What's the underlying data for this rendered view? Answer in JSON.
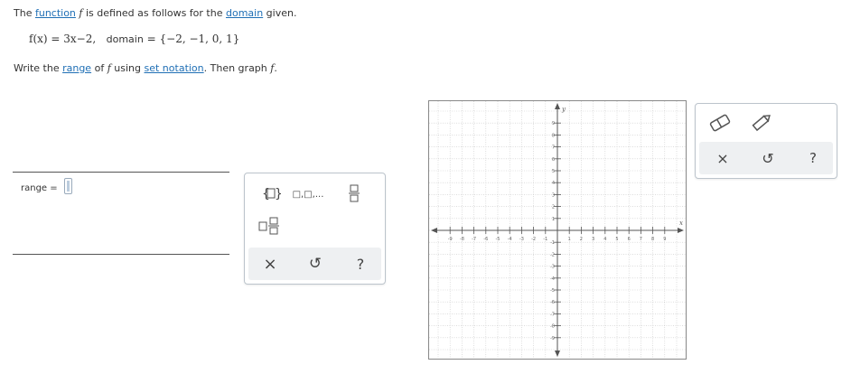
{
  "question": {
    "p1_before": "The ",
    "p1_link1": "function",
    "p1_fname": "f",
    "p1_mid": " is defined as follows for the ",
    "p1_link2": "domain",
    "p1_after": " given.",
    "eq_lhs": "f(x) = 3x−2,",
    "eq_domain_label": "domain",
    "eq_domain_value": "= {−2, −1, 0, 1}",
    "p3_before": "Write the ",
    "p3_link1": "range",
    "p3_mid": " of ",
    "p3_fname": "f",
    "p3_mid2": " using ",
    "p3_link2": "set notation",
    "p3_mid3": ". Then graph ",
    "p3_fname2": "f",
    "p3_end": "."
  },
  "answer": {
    "range_label": "range  =",
    "range_value": ""
  },
  "math_palette": {
    "buttons": [
      "set-braces",
      "list-items",
      "fraction",
      "mixed-number",
      "clear",
      "undo",
      "help"
    ],
    "set_list_label": "□,□,...",
    "help_label": "?",
    "clear_label": "×",
    "undo_label": "↺"
  },
  "graph": {
    "x_axis_label": "x",
    "y_axis_label": "y",
    "x_min": -10,
    "x_max": 10,
    "y_min": -10,
    "y_max": 10,
    "x_ticks": [
      -9,
      -8,
      -7,
      -6,
      -5,
      -4,
      -3,
      -2,
      -1,
      1,
      2,
      3,
      4,
      5,
      6,
      7,
      8,
      9
    ],
    "y_ticks": [
      9,
      8,
      7,
      6,
      5,
      4,
      3,
      2,
      1,
      -1,
      -2,
      -3,
      -4,
      -5,
      -6,
      -7,
      -8,
      -9
    ],
    "grid": true
  },
  "graph_tools": {
    "clear_label": "×",
    "undo_label": "↺",
    "help_label": "?",
    "tools": [
      "eraser-tool",
      "pencil-tool"
    ]
  },
  "colors": {
    "link": "#1f6fb5",
    "palette_border": "#bcc4cc",
    "strip_bg": "#eef0f2",
    "grid": "#c8c8c8",
    "axis": "#555555"
  }
}
